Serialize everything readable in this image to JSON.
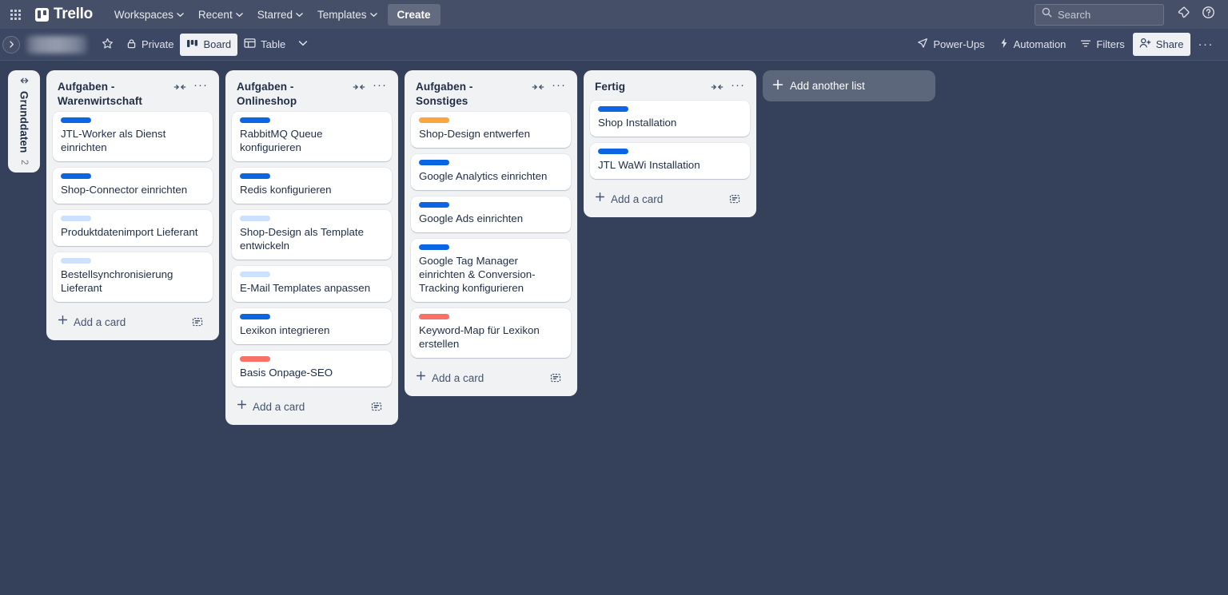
{
  "topnav": {
    "apps_icon": "grid-apps-icon",
    "brand": "Trello",
    "menus": [
      {
        "label": "Workspaces",
        "has_caret": true
      },
      {
        "label": "Recent",
        "has_caret": true
      },
      {
        "label": "Starred",
        "has_caret": true
      },
      {
        "label": "Templates",
        "has_caret": true
      }
    ],
    "create_label": "Create",
    "search": {
      "placeholder": "Search",
      "value": "",
      "icon": "search-icon"
    },
    "notifications_icon": "notification-bell-icon",
    "help_icon": "help-circle-icon"
  },
  "boardbar": {
    "sidebar_toggle_icon": "chevron-right-icon",
    "board_title": "",
    "star_icon": "star-icon",
    "visibility": {
      "label": "Private",
      "icon": "lock-icon"
    },
    "views": [
      {
        "label": "Board",
        "icon": "board-view-icon",
        "active": true
      },
      {
        "label": "Table",
        "icon": "table-view-icon",
        "active": false
      }
    ],
    "views_caret_icon": "chevron-down-icon",
    "actions": [
      {
        "label": "Power-Ups",
        "icon": "power-ups-icon"
      },
      {
        "label": "Automation",
        "icon": "lightning-bolt-icon"
      },
      {
        "label": "Filters",
        "icon": "filter-icon"
      }
    ],
    "share": {
      "label": "Share",
      "icon": "person-add-icon"
    },
    "overflow_label": "···"
  },
  "board": {
    "collapsed_list": {
      "title": "Grunddaten",
      "count": "2",
      "expand_icon": "expand-horizontal-icon"
    },
    "lists": [
      {
        "title": "Aufgaben - Warenwirtschaft",
        "collapse_icon": "collapse-list-icon",
        "menu_icon": "list-actions-icon",
        "add_card_label": "Add a card",
        "template_icon": "card-template-icon",
        "cards": [
          {
            "title": "JTL-Worker als Dienst einrichten",
            "label_color": "#0c66e4"
          },
          {
            "title": "Shop-Connector einrichten",
            "label_color": "#0c66e4"
          },
          {
            "title": "Produktdatenimport Lieferant",
            "label_color": "#cce0ff"
          },
          {
            "title": "Bestellsynchronisierung Lieferant",
            "label_color": "#cce0ff"
          }
        ]
      },
      {
        "title": "Aufgaben - Onlineshop",
        "collapse_icon": "collapse-list-icon",
        "menu_icon": "list-actions-icon",
        "add_card_label": "Add a card",
        "template_icon": "card-template-icon",
        "cards": [
          {
            "title": "RabbitMQ Queue konfigurieren",
            "label_color": "#0c66e4"
          },
          {
            "title": "Redis konfigurieren",
            "label_color": "#0c66e4"
          },
          {
            "title": "Shop-Design als Template entwickeln",
            "label_color": "#cce0ff"
          },
          {
            "title": "E-Mail Templates anpassen",
            "label_color": "#cce0ff"
          },
          {
            "title": "Lexikon integrieren",
            "label_color": "#0c66e4"
          },
          {
            "title": "Basis Onpage-SEO",
            "label_color": "#f87168"
          }
        ]
      },
      {
        "title": "Aufgaben - Sonstiges",
        "collapse_icon": "collapse-list-icon",
        "menu_icon": "list-actions-icon",
        "add_card_label": "Add a card",
        "template_icon": "card-template-icon",
        "cards": [
          {
            "title": "Shop-Design entwerfen",
            "label_color": "#faa53d"
          },
          {
            "title": "Google Analytics einrichten",
            "label_color": "#0c66e4"
          },
          {
            "title": "Google Ads einrichten",
            "label_color": "#0c66e4"
          },
          {
            "title": "Google Tag Manager einrichten & Conversion-Tracking konfigurieren",
            "label_color": "#0c66e4"
          },
          {
            "title": "Keyword-Map für Lexikon erstellen",
            "label_color": "#f87168"
          }
        ]
      },
      {
        "title": "Fertig",
        "collapse_icon": "collapse-list-icon",
        "menu_icon": "list-actions-icon",
        "add_card_label": "Add a card",
        "template_icon": "card-template-icon",
        "cards": [
          {
            "title": "Shop Installation",
            "label_color": "#0c66e4"
          },
          {
            "title": "JTL WaWi Installation",
            "label_color": "#0c66e4"
          }
        ]
      }
    ],
    "add_list_label": "Add another list",
    "add_list_icon": "plus-icon"
  },
  "colors": {
    "topnav_bg": "#454f67",
    "boardbar_bg": "#3c4763",
    "canvas_bg": "#35415a",
    "list_bg": "#f1f2f4",
    "card_bg": "#ffffff",
    "label_blue": "#0c66e4",
    "label_light_blue": "#cce0ff",
    "label_red": "#f87168",
    "label_orange": "#faa53d"
  }
}
